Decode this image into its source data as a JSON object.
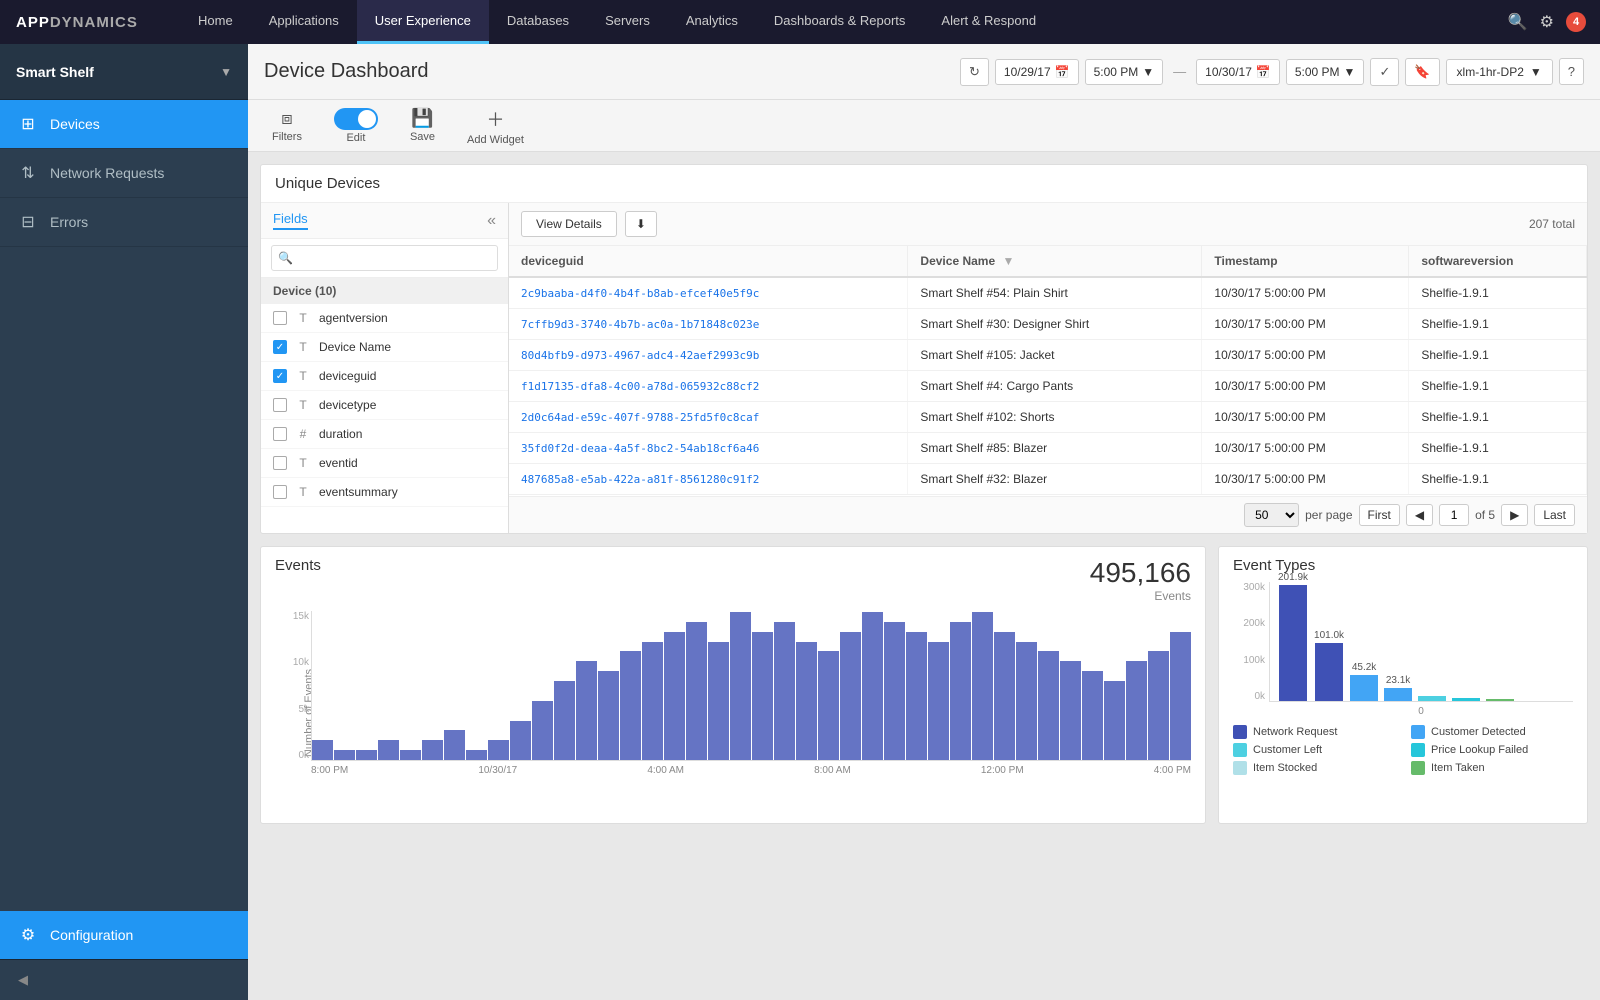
{
  "logo": {
    "text_bold": "APP",
    "text_normal": "DYNAMICS"
  },
  "nav": {
    "items": [
      {
        "label": "Home",
        "active": false
      },
      {
        "label": "Applications",
        "active": false
      },
      {
        "label": "User Experience",
        "active": true
      },
      {
        "label": "Databases",
        "active": false
      },
      {
        "label": "Servers",
        "active": false
      },
      {
        "label": "Analytics",
        "active": false
      },
      {
        "label": "Dashboards & Reports",
        "active": false
      },
      {
        "label": "Alert & Respond",
        "active": false
      }
    ],
    "badge": "4"
  },
  "sidebar": {
    "app_name": "Smart Shelf",
    "items": [
      {
        "id": "devices",
        "label": "Devices",
        "active": true,
        "icon": "▦"
      },
      {
        "id": "network",
        "label": "Network Requests",
        "active": false,
        "icon": "↕"
      },
      {
        "id": "errors",
        "label": "Errors",
        "active": false,
        "icon": "⊡"
      }
    ],
    "config_label": "Configuration",
    "collapse_icon": "◀"
  },
  "page_header": {
    "title": "Device Dashboard",
    "refresh_icon": "↻",
    "start_date": "10/29/17",
    "start_time": "5:00 PM",
    "end_date": "10/30/17",
    "end_time": "5:00 PM",
    "preset": "xlm-1hr-DP2",
    "check_icon": "✓",
    "save_icon": "⬛",
    "help_icon": "?"
  },
  "toolbar": {
    "filters_label": "Filters",
    "edit_label": "Edit",
    "save_label": "Save",
    "add_widget_label": "Add Widget"
  },
  "unique_devices": {
    "title": "Unique Devices",
    "fields_tab": "Fields",
    "view_details_btn": "View Details",
    "total": "207 total",
    "search_placeholder": "",
    "group_label": "Device (10)",
    "fields": [
      {
        "name": "agentversion",
        "type": "T",
        "checked": false
      },
      {
        "name": "Device Name",
        "type": "T",
        "checked": true
      },
      {
        "name": "deviceguid",
        "type": "T",
        "checked": true
      },
      {
        "name": "devicetype",
        "type": "T",
        "checked": false
      },
      {
        "name": "duration",
        "type": "#",
        "checked": false
      },
      {
        "name": "eventid",
        "type": "T",
        "checked": false
      },
      {
        "name": "eventsummary",
        "type": "T",
        "checked": false
      }
    ],
    "table_columns": [
      "deviceguid",
      "Device Name",
      "Timestamp",
      "softwareversion"
    ],
    "table_rows": [
      {
        "deviceguid": "2c9baaba-d4f0-4b4f-b8ab-efcef40e5f9c",
        "device_name": "Smart Shelf #54: Plain Shirt",
        "timestamp": "10/30/17 5:00:00 PM",
        "softwareversion": "Shelfie-1.9.1"
      },
      {
        "deviceguid": "7cffb9d3-3740-4b7b-ac0a-1b71848c023e",
        "device_name": "Smart Shelf #30: Designer Shirt",
        "timestamp": "10/30/17 5:00:00 PM",
        "softwareversion": "Shelfie-1.9.1"
      },
      {
        "deviceguid": "80d4bfb9-d973-4967-adc4-42aef2993c9b",
        "device_name": "Smart Shelf #105: Jacket",
        "timestamp": "10/30/17 5:00:00 PM",
        "softwareversion": "Shelfie-1.9.1"
      },
      {
        "deviceguid": "f1d17135-dfa8-4c00-a78d-065932c88cf2",
        "device_name": "Smart Shelf #4: Cargo Pants",
        "timestamp": "10/30/17 5:00:00 PM",
        "softwareversion": "Shelfie-1.9.1"
      },
      {
        "deviceguid": "2d0c64ad-e59c-407f-9788-25fd5f0c8caf",
        "device_name": "Smart Shelf #102: Shorts",
        "timestamp": "10/30/17 5:00:00 PM",
        "softwareversion": "Shelfie-1.9.1"
      },
      {
        "deviceguid": "35fd0f2d-deaa-4a5f-8bc2-54ab18cf6a46",
        "device_name": "Smart Shelf #85: Blazer",
        "timestamp": "10/30/17 5:00:00 PM",
        "softwareversion": "Shelfie-1.9.1"
      },
      {
        "deviceguid": "487685a8-e5ab-422a-a81f-8561280c91f2",
        "device_name": "Smart Shelf #32: Blazer",
        "timestamp": "10/30/17 5:00:00 PM",
        "softwareversion": "Shelfie-1.9.1"
      }
    ],
    "pagination": {
      "per_page": "50",
      "per_page_label": "per page",
      "first_label": "First",
      "last_label": "Last",
      "current_page": "1",
      "total_pages": "of 5"
    }
  },
  "events": {
    "title": "Events",
    "total_number": "495,166",
    "total_label": "Events",
    "y_label": "Number of Events",
    "y_axis": [
      "15k",
      "10k",
      "5k",
      "0k"
    ],
    "x_axis": [
      "8:00 PM",
      "10/30/17",
      "4:00 AM",
      "8:00 AM",
      "12:00 PM",
      "4:00 PM"
    ],
    "bars": [
      2,
      1,
      1,
      2,
      1,
      2,
      3,
      1,
      2,
      4,
      6,
      8,
      10,
      9,
      11,
      12,
      13,
      14,
      12,
      15,
      13,
      14,
      12,
      11,
      13,
      15,
      14,
      13,
      12,
      14,
      15,
      13,
      12,
      11,
      10,
      9,
      8,
      10,
      11,
      13
    ]
  },
  "event_types": {
    "title": "Event Types",
    "y_axis": [
      "300k",
      "200k",
      "100k",
      "0k"
    ],
    "bars": [
      {
        "label": "",
        "value": 201.9,
        "color": "#3f51b5",
        "display": "201.9k"
      },
      {
        "label": "",
        "value": 101.0,
        "color": "#3f51b5",
        "display": "101.0k"
      },
      {
        "label": "",
        "value": 45.2,
        "color": "#42a5f5",
        "display": "45.2k"
      },
      {
        "label": "",
        "value": 23.1,
        "color": "#42a5f5",
        "display": "23.1k"
      },
      {
        "label": "",
        "value": 8,
        "color": "#4dd0e1",
        "display": ""
      },
      {
        "label": "",
        "value": 5,
        "color": "#26c6da",
        "display": ""
      },
      {
        "label": "",
        "value": 4,
        "color": "#66bb6a",
        "display": ""
      }
    ],
    "x_label": "0",
    "legend": [
      {
        "label": "Network Request",
        "color": "#3f51b5"
      },
      {
        "label": "Customer Detected",
        "color": "#42a5f5"
      },
      {
        "label": "Customer Left",
        "color": "#4dd0e1"
      },
      {
        "label": "Price Lookup Failed",
        "color": "#26c6da"
      },
      {
        "label": "Item Stocked",
        "color": "#b0e0e8"
      },
      {
        "label": "Item Taken",
        "color": "#66bb6a"
      }
    ]
  }
}
